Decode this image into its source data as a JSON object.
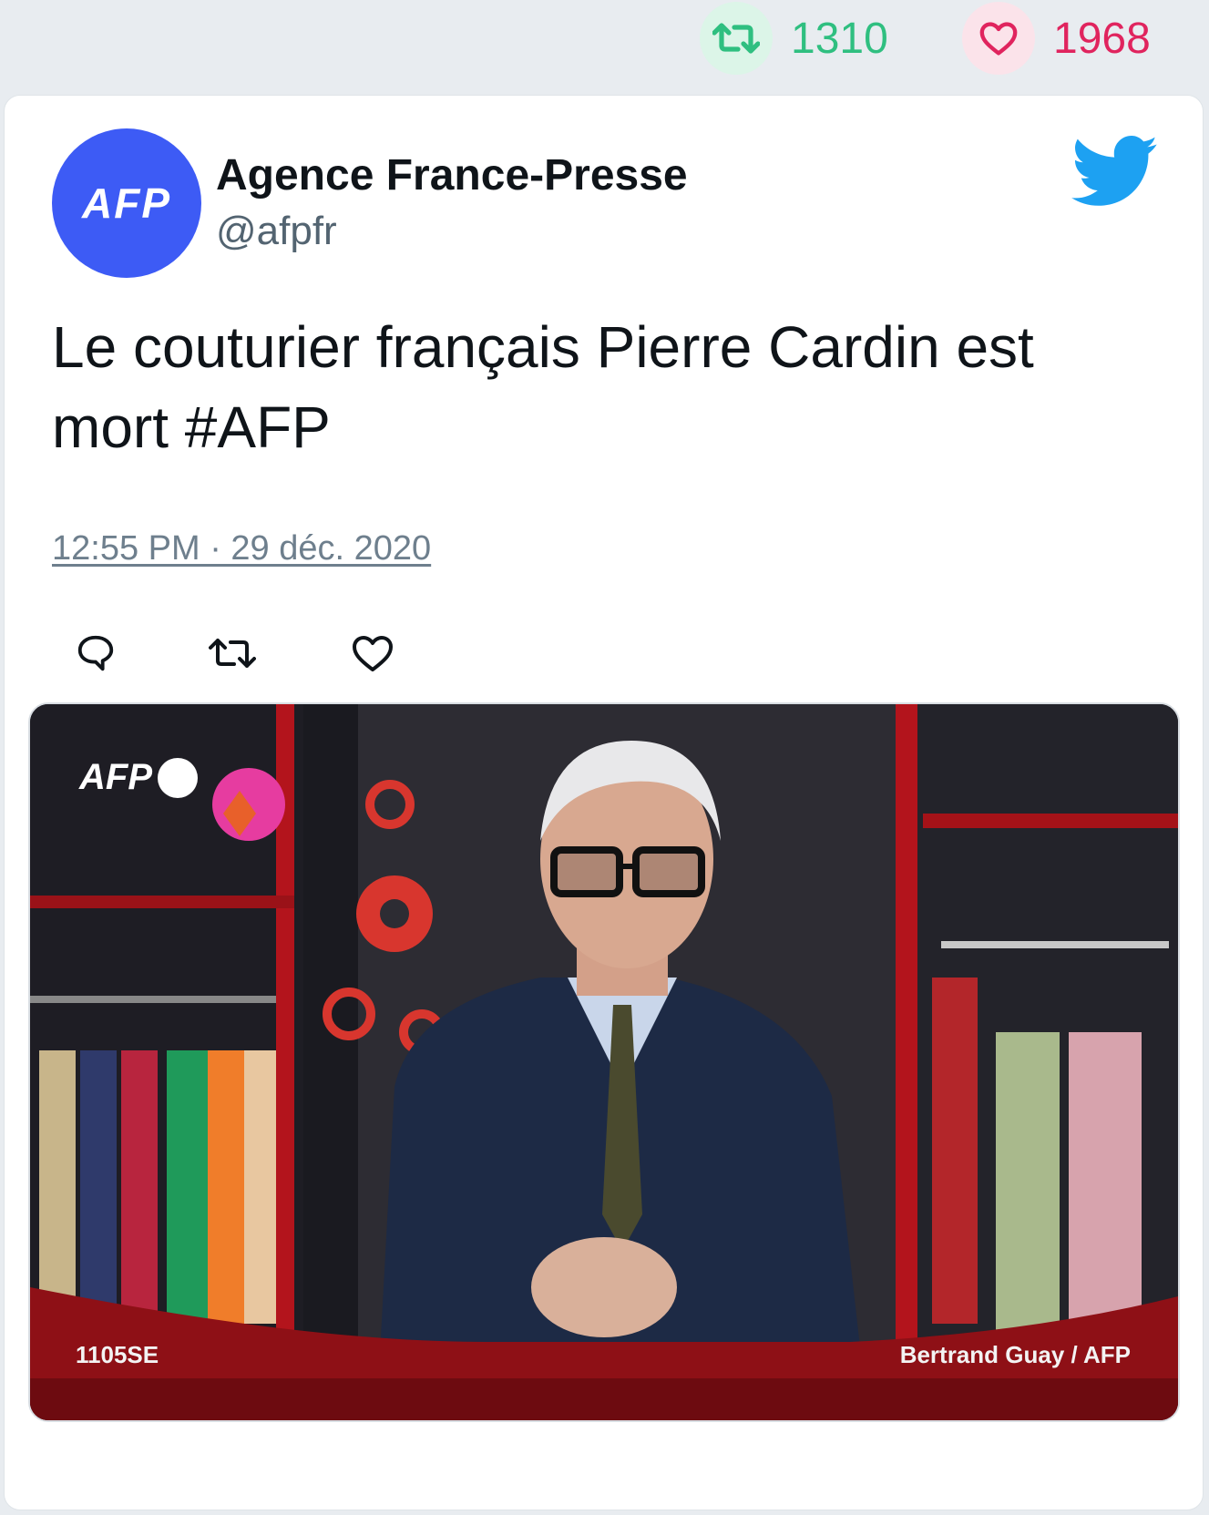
{
  "stats": {
    "retweets": "1310",
    "likes": "1968",
    "retweet_color": "#2fbf80",
    "like_color": "#e0245e",
    "retweet_icon": "retweet-icon",
    "like_icon": "heart-icon"
  },
  "tweet": {
    "avatar_text": "AFP",
    "author_name": "Agence France-Presse",
    "author_handle": "@afpfr",
    "text": "Le couturier français Pierre Cardin est mort #AFP",
    "timestamp": "12:55 PM · 29 déc. 2020",
    "platform_icon": "twitter-bird-icon",
    "brand_color": "#1da1f2",
    "avatar_color": "#3d5bf5",
    "actions": [
      {
        "name": "reply",
        "icon": "reply-icon"
      },
      {
        "name": "retweet",
        "icon": "retweet-icon"
      },
      {
        "name": "like",
        "icon": "heart-icon"
      }
    ]
  },
  "photo": {
    "watermark_logo": "AFP",
    "code": "1105SE",
    "credit": "Bertrand Guay / AFP"
  }
}
